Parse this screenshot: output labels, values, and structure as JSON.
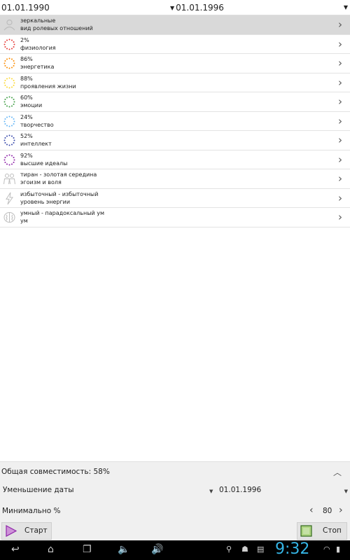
{
  "topbar": {
    "date_left": "01.01.1990",
    "date_right": "01.01.1996"
  },
  "rows": [
    {
      "icon": "people-icon",
      "label1": "зеркальные",
      "label2": "вид ролевых отношений",
      "color": "#bdbdbd",
      "selected": true
    },
    {
      "icon": "cycle-icon",
      "label1": "2%",
      "label2": "физиология",
      "color": "#e53935"
    },
    {
      "icon": "cycle-icon",
      "label1": "86%",
      "label2": "энергетика",
      "color": "#fb8c00"
    },
    {
      "icon": "cycle-icon",
      "label1": "88%",
      "label2": "проявления жизни",
      "color": "#fdd835"
    },
    {
      "icon": "cycle-icon",
      "label1": "60%",
      "label2": "эмоции",
      "color": "#43a047"
    },
    {
      "icon": "cycle-icon",
      "label1": "24%",
      "label2": "творчество",
      "color": "#64b5f6"
    },
    {
      "icon": "cycle-icon",
      "label1": "52%",
      "label2": "интеллект",
      "color": "#3949ab"
    },
    {
      "icon": "cycle-icon",
      "label1": "92%",
      "label2": "высшие идеалы",
      "color": "#8e24aa"
    },
    {
      "icon": "couple-icon",
      "label1": "тиран - золотая середина",
      "label2": "эгоизм и воля",
      "color": "#bdbdbd"
    },
    {
      "icon": "lightning-icon",
      "label1": "избыточный - избыточный",
      "label2": "уровень энергии",
      "color": "#bdbdbd"
    },
    {
      "icon": "brain-icon",
      "label1": "умный - парадоксальный ум",
      "label2": "ум",
      "color": "#bdbdbd"
    }
  ],
  "bottom": {
    "compat_label": "Общая совместимость: 58%",
    "mode_label": "Уменьшение даты",
    "mode_date": "01.01.1996",
    "min_label": "Минимально %",
    "min_value": "80",
    "start_label": "Старт",
    "stop_label": "Стоп"
  },
  "sysbar": {
    "time": "9:32"
  },
  "colors": {
    "start": "#9c27b0",
    "stop": "#8bc34a",
    "clock": "#35b5e5"
  }
}
